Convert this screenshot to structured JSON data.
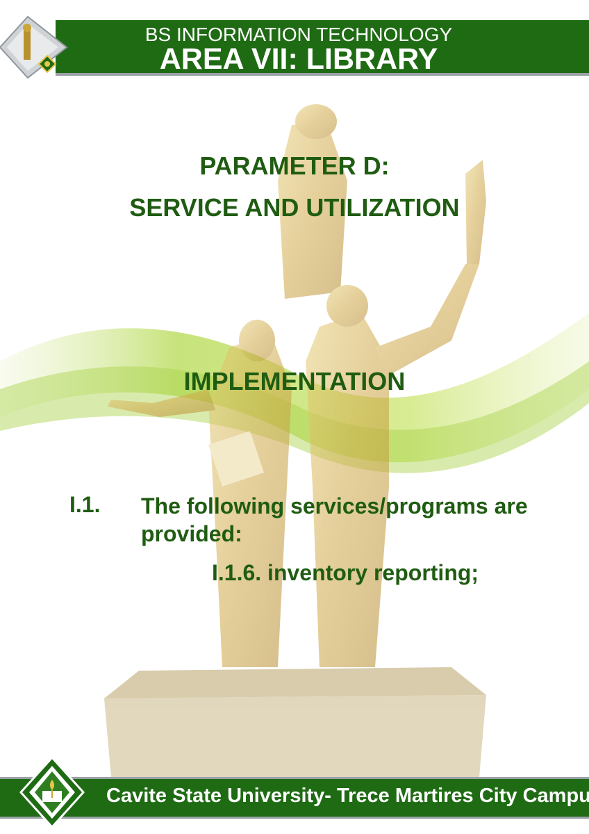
{
  "header": {
    "program": "BS INFORMATION TECHNOLOGY",
    "area": "AREA VII: LIBRARY"
  },
  "main": {
    "parameter": "PARAMETER D:",
    "subtitle": "SERVICE AND UTILIZATION",
    "section": "IMPLEMENTATION",
    "item": {
      "number": "I.1.",
      "text": "The following services/programs are provided:",
      "subitem": "I.1.6. inventory reporting;"
    }
  },
  "footer": {
    "text": "Cavite State University- Trece Martires City Campus"
  },
  "colors": {
    "primary_green": "#1f6b14",
    "text_green": "#1f5c12",
    "accent_gold": "#c9a53a"
  },
  "icons": {
    "header_logo": "statue-diamond-logo-icon",
    "footer_logo": "university-seal-icon"
  }
}
